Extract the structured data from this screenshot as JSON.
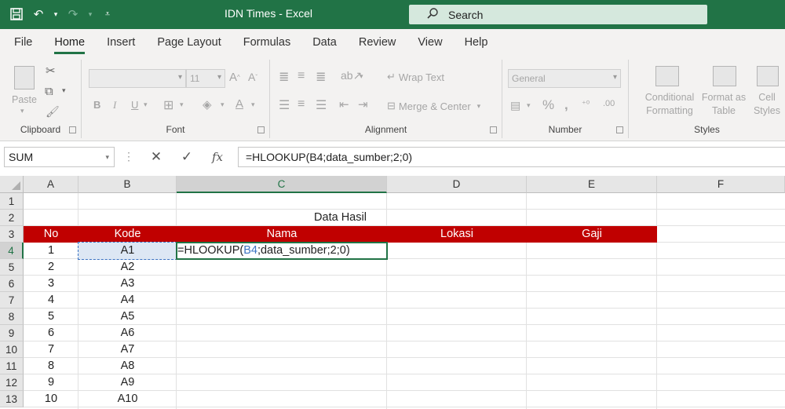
{
  "window": {
    "title": "IDN Times  -  Excel"
  },
  "search": {
    "label": "Search"
  },
  "tabs": [
    "File",
    "Home",
    "Insert",
    "Page Layout",
    "Formulas",
    "Data",
    "Review",
    "View",
    "Help"
  ],
  "ribbon": {
    "clipboard": {
      "paste": "Paste",
      "label": "Clipboard"
    },
    "font": {
      "size": "11",
      "label": "Font"
    },
    "alignment": {
      "wrap": "Wrap Text",
      "merge": "Merge & Center",
      "label": "Alignment"
    },
    "number": {
      "format": "General",
      "label": "Number"
    },
    "styles": {
      "conditional": "Conditional Formatting",
      "format_as_table": "Format as Table",
      "cell_styles": "Cell Styles",
      "label": "Styles"
    }
  },
  "formula_bar": {
    "name_box": "SUM",
    "formula": "=HLOOKUP(B4;data_sumber;2;0)"
  },
  "sheet": {
    "columns": [
      "A",
      "B",
      "C",
      "D",
      "E",
      "F"
    ],
    "rows": [
      "1",
      "2",
      "3",
      "4",
      "5",
      "6",
      "7",
      "8",
      "9",
      "10",
      "11",
      "12",
      "13"
    ],
    "title": "Data Hasil",
    "headers": [
      "No",
      "Kode",
      "Nama",
      "Lokasi",
      "Gaji"
    ],
    "no": [
      "1",
      "2",
      "3",
      "4",
      "5",
      "6",
      "7",
      "8",
      "9",
      "10"
    ],
    "kode": [
      "A1",
      "A2",
      "A3",
      "A4",
      "A5",
      "A6",
      "A7",
      "A8",
      "A9",
      "A10"
    ],
    "edit": {
      "prefix": "=HLOOKUP(",
      "ref": "B4",
      "suffix": ";data_sumber;2;0)"
    },
    "header_color": "#c00000",
    "accent": "#217346"
  }
}
